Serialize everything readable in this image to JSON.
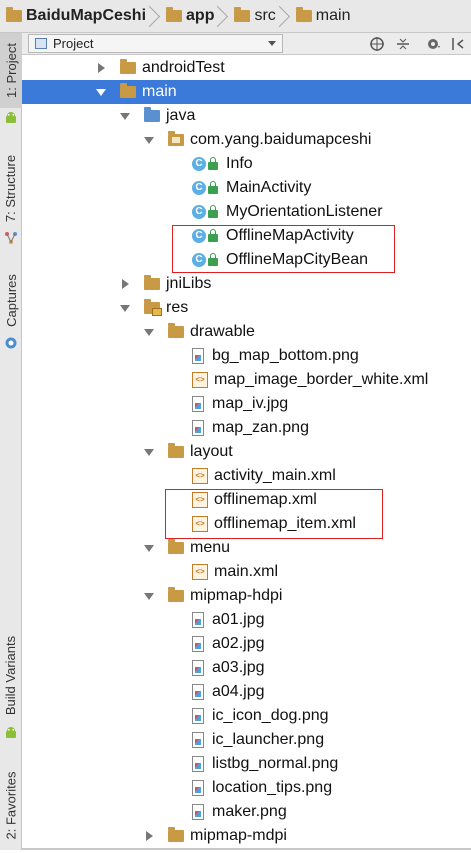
{
  "breadcrumb": [
    {
      "label": "BaiduMapCeshi",
      "bold": true,
      "icon": "project-folder-icon"
    },
    {
      "label": "app",
      "bold": true,
      "icon": "module-folder-icon"
    },
    {
      "label": "src",
      "bold": false,
      "icon": "folder-icon"
    },
    {
      "label": "main",
      "bold": false,
      "icon": "folder-icon"
    }
  ],
  "sidebar": {
    "tabs": [
      "1: Project",
      "7: Structure",
      "Captures",
      "Build Variants",
      "2: Favorites"
    ]
  },
  "toolbar": {
    "view_select": "Project",
    "icons": [
      "sync-icon",
      "collapse-icon",
      "settings-icon",
      "hide-icon"
    ]
  },
  "tree": [
    {
      "label": "androidTest",
      "type": "folder",
      "arrow": "right"
    },
    {
      "label": "main",
      "type": "folder",
      "arrow": "down",
      "selected": true
    },
    {
      "label": "java",
      "type": "source-folder",
      "arrow": "down"
    },
    {
      "label": "com.yang.baidumapceshi",
      "type": "package",
      "arrow": "down"
    },
    {
      "label": "Info",
      "type": "class"
    },
    {
      "label": "MainActivity",
      "type": "class"
    },
    {
      "label": "MyOrientationListener",
      "type": "class"
    },
    {
      "label": "OfflineMapActivity",
      "type": "class"
    },
    {
      "label": "OfflineMapCityBean",
      "type": "class"
    },
    {
      "label": "jniLibs",
      "type": "folder",
      "arrow": "right"
    },
    {
      "label": "res",
      "type": "res-folder",
      "arrow": "down"
    },
    {
      "label": "drawable",
      "type": "folder",
      "arrow": "down"
    },
    {
      "label": "bg_map_bottom.png",
      "type": "image"
    },
    {
      "label": "map_image_border_white.xml",
      "type": "xml"
    },
    {
      "label": "map_iv.jpg",
      "type": "image"
    },
    {
      "label": "map_zan.png",
      "type": "image"
    },
    {
      "label": "layout",
      "type": "folder",
      "arrow": "down"
    },
    {
      "label": "activity_main.xml",
      "type": "xml"
    },
    {
      "label": "offlinemap.xml",
      "type": "xml"
    },
    {
      "label": "offlinemap_item.xml",
      "type": "xml"
    },
    {
      "label": "menu",
      "type": "folder",
      "arrow": "down"
    },
    {
      "label": "main.xml",
      "type": "xml"
    },
    {
      "label": "mipmap-hdpi",
      "type": "folder",
      "arrow": "down"
    },
    {
      "label": "a01.jpg",
      "type": "image"
    },
    {
      "label": "a02.jpg",
      "type": "image"
    },
    {
      "label": "a03.jpg",
      "type": "image"
    },
    {
      "label": "a04.jpg",
      "type": "image"
    },
    {
      "label": "ic_icon_dog.png",
      "type": "image"
    },
    {
      "label": "ic_launcher.png",
      "type": "image"
    },
    {
      "label": "listbg_normal.png",
      "type": "image"
    },
    {
      "label": "location_tips.png",
      "type": "image"
    },
    {
      "label": "maker.png",
      "type": "image"
    },
    {
      "label": "mipmap-mdpi",
      "type": "folder",
      "arrow": "right"
    }
  ],
  "colors": {
    "selection": "#3b7ad9",
    "highlight_box": "#e02020"
  }
}
